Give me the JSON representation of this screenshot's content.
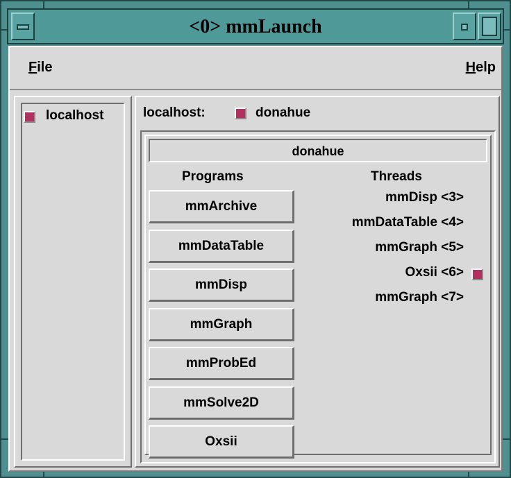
{
  "window": {
    "title": "<0> mmLaunch"
  },
  "menubar": {
    "file": {
      "mnemonic": "F",
      "rest": "ile"
    },
    "help": {
      "mnemonic": "H",
      "rest": "elp"
    }
  },
  "hosts": [
    {
      "label": "localhost"
    }
  ],
  "account_bar": {
    "host_label": "localhost:",
    "account": "donahue"
  },
  "account_panel": {
    "title": "donahue",
    "programs_header": "Programs",
    "threads_header": "Threads"
  },
  "programs": [
    {
      "label": "mmArchive"
    },
    {
      "label": "mmDataTable"
    },
    {
      "label": "mmDisp"
    },
    {
      "label": "mmGraph"
    },
    {
      "label": "mmProbEd"
    },
    {
      "label": "mmSolve2D"
    },
    {
      "label": "Oxsii"
    }
  ],
  "threads": [
    {
      "label": "mmDisp <3>",
      "has_control": false
    },
    {
      "label": "mmDataTable <4>",
      "has_control": false
    },
    {
      "label": "mmGraph <5>",
      "has_control": false
    },
    {
      "label": "Oxsii <6>",
      "has_control": true
    },
    {
      "label": "mmGraph <7>",
      "has_control": false
    }
  ],
  "colors": {
    "frame": "#4f8f8f",
    "titlebar": "#4f9999",
    "background": "#d9d9d9",
    "indicator": "#b03060"
  }
}
